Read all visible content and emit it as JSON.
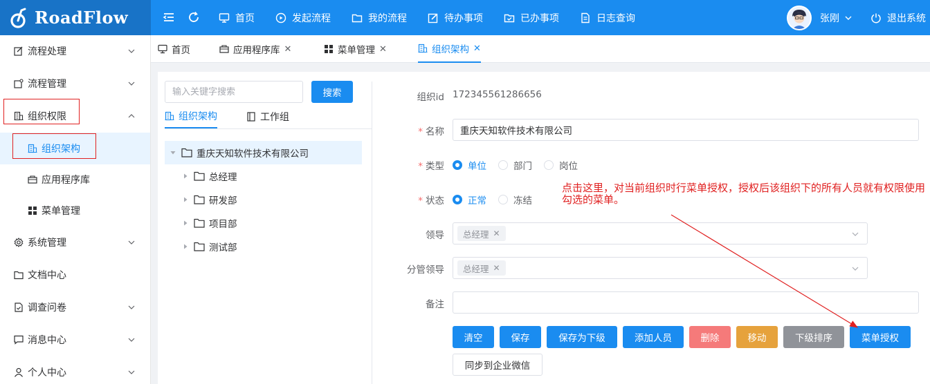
{
  "app": {
    "logo_text": "RoadFlow"
  },
  "topnav": {
    "items": [
      {
        "label": "首页",
        "icon": "monitor-icon"
      },
      {
        "label": "发起流程",
        "icon": "play-circle-icon"
      },
      {
        "label": "我的流程",
        "icon": "folder-icon"
      },
      {
        "label": "待办事项",
        "icon": "edit-icon"
      },
      {
        "label": "已办事项",
        "icon": "folder-checked-icon"
      },
      {
        "label": "日志查询",
        "icon": "document-icon"
      }
    ],
    "username": "张刚",
    "logout_label": "退出系统"
  },
  "sidebar": {
    "items": [
      {
        "label": "流程处理",
        "icon": "edit-icon"
      },
      {
        "label": "流程管理",
        "icon": "share-icon"
      },
      {
        "label": "组织权限",
        "icon": "office-building-icon"
      },
      {
        "label": "组织架构",
        "icon": "office-building-icon"
      },
      {
        "label": "应用程序库",
        "icon": "suitcase-icon"
      },
      {
        "label": "菜单管理",
        "icon": "grid-icon"
      },
      {
        "label": "系统管理",
        "icon": "gear-icon"
      },
      {
        "label": "文档中心",
        "icon": "folder-icon"
      },
      {
        "label": "调查问卷",
        "icon": "document-checked-icon"
      },
      {
        "label": "消息中心",
        "icon": "chat-icon"
      },
      {
        "label": "个人中心",
        "icon": "user-icon"
      }
    ]
  },
  "tabs": [
    {
      "label": "首页"
    },
    {
      "label": "应用程序库"
    },
    {
      "label": "菜单管理"
    },
    {
      "label": "组织架构"
    }
  ],
  "left": {
    "search_placeholder": "输入关键字搜索",
    "search_button": "搜索",
    "subtabs": [
      "组织架构",
      "工作组"
    ],
    "tree": {
      "root": "重庆天知软件技术有限公司",
      "children": [
        "总经理",
        "研发部",
        "项目部",
        "测试部"
      ]
    }
  },
  "form": {
    "id_label": "组织id",
    "id_value": "172345561286656",
    "name_label": "名称",
    "name_value": "重庆天知软件技术有限公司",
    "type_label": "类型",
    "type_options": [
      "单位",
      "部门",
      "岗位"
    ],
    "type_selected": "单位",
    "status_label": "状态",
    "status_options": [
      "正常",
      "冻结"
    ],
    "status_selected": "正常",
    "leader_label": "领导",
    "leader_tag": "总经理",
    "charge_label": "分管领导",
    "charge_tag": "总经理",
    "note_label": "备注",
    "note_value": ""
  },
  "buttons": {
    "clear": "清空",
    "save": "保存",
    "save_sub": "保存为下级",
    "add_person": "添加人员",
    "delete": "删除",
    "move": "移动",
    "sort": "下级排序",
    "menu_auth": "菜单授权",
    "sync_wechat": "同步到企业微信"
  },
  "annotation": {
    "text": "点击这里，对当前组织时行菜单授权，授权后该组织下的所有人员就有权限使用勾选的菜单。"
  },
  "colors": {
    "primary": "#1a8cf0",
    "logo_bg": "#1873c7",
    "danger": "#f56c6c",
    "warning": "#e6a23c",
    "info": "#909399",
    "annotation": "#e02020"
  }
}
